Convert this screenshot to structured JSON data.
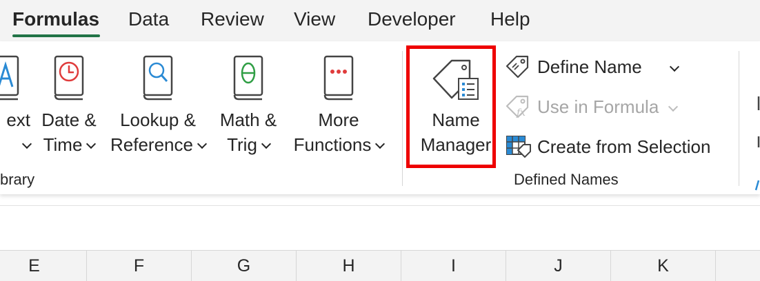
{
  "tabs": [
    {
      "label": "Formulas",
      "active": true
    },
    {
      "label": "Data"
    },
    {
      "label": "Review"
    },
    {
      "label": "View"
    },
    {
      "label": "Developer"
    },
    {
      "label": "Help"
    }
  ],
  "function_library": {
    "text_label_line1": "ext",
    "group_label": "brary",
    "buttons": [
      {
        "line1": "Date &",
        "line2": "Time",
        "icon": "clock-book-icon"
      },
      {
        "line1": "Lookup &",
        "line2": "Reference",
        "icon": "magnifier-book-icon"
      },
      {
        "line1": "Math &",
        "line2": "Trig",
        "icon": "theta-book-icon"
      },
      {
        "line1": "More",
        "line2": "Functions",
        "icon": "dots-book-icon"
      }
    ]
  },
  "defined_names": {
    "name_manager": {
      "line1": "Name",
      "line2": "Manager",
      "icon": "name-tag-list-icon"
    },
    "define_name": "Define Name",
    "use_in_formula": "Use in Formula",
    "create_from_selection": "Create from Selection",
    "group_label": "Defined Names"
  },
  "columns": [
    "E",
    "F",
    "G",
    "H",
    "I",
    "J",
    "K"
  ],
  "colors": {
    "accent_green": "#217346",
    "highlight_red": "#ee0000",
    "icon_red": "#e03c3c",
    "icon_blue": "#2a8ad4",
    "icon_green": "#2f9e44"
  }
}
